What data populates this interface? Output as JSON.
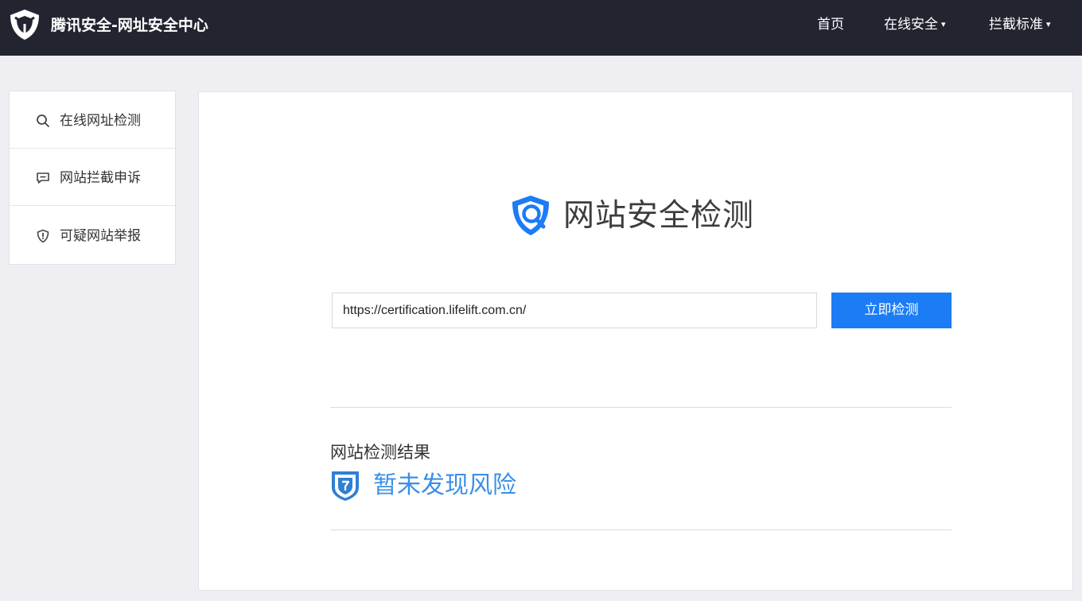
{
  "header": {
    "brand": "腾讯安全-网址安全中心",
    "nav": [
      {
        "label": "首页",
        "has_dropdown": false
      },
      {
        "label": "在线安全",
        "has_dropdown": true
      },
      {
        "label": "拦截标准",
        "has_dropdown": true
      }
    ],
    "caret": "▾"
  },
  "sidebar": {
    "items": [
      {
        "label": "在线网址检测",
        "icon": "search-icon"
      },
      {
        "label": "网站拦截申诉",
        "icon": "message-icon"
      },
      {
        "label": "可疑网站举报",
        "icon": "shield-alert-icon"
      }
    ]
  },
  "main": {
    "title": "网站安全检测",
    "url_input": {
      "value": "https://certification.lifelift.com.cn/",
      "placeholder": ""
    },
    "check_button": "立即检测",
    "result_heading": "网站检测结果",
    "result_text": "暂未发现风险"
  },
  "colors": {
    "topbar": "#222530",
    "accent": "#1b7cf6",
    "result": "#3a8fe8",
    "page_bg": "#efeff3"
  }
}
